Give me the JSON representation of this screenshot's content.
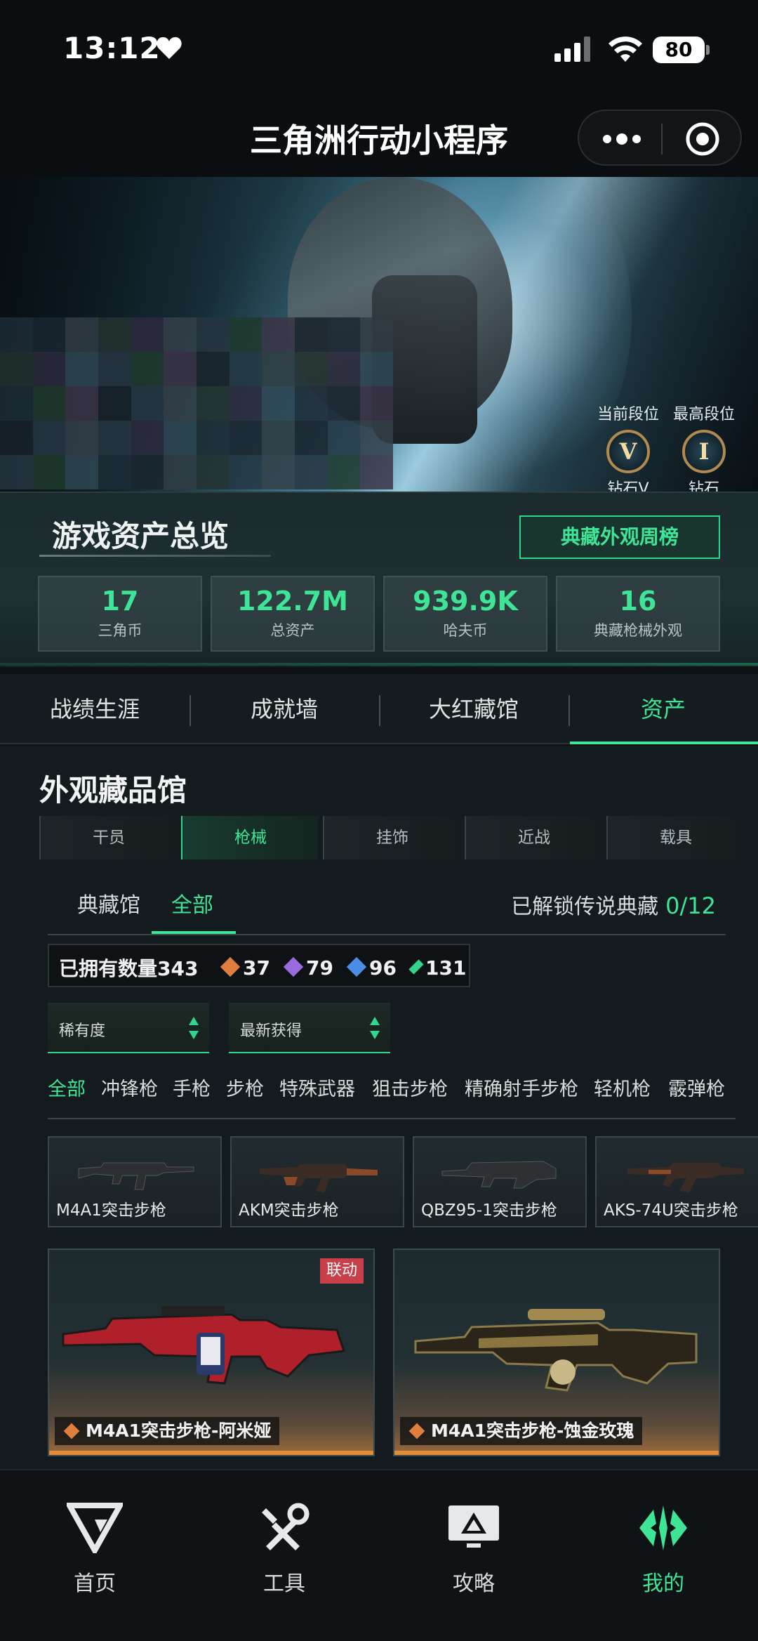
{
  "status_bar": {
    "time": "13:12",
    "battery": "80"
  },
  "title_bar": {
    "title": "三角洲行动小程序"
  },
  "hero": {
    "current_rank_label": "当前段位",
    "current_rank": "钻石V",
    "current_rank_numeral": "V",
    "highest_rank_label": "最高段位",
    "highest_rank": "钻石",
    "highest_rank_numeral": "I"
  },
  "assets": {
    "title": "游戏资产总览",
    "weekly_button": "典藏外观周榜",
    "stats": [
      {
        "value": "17",
        "label": "三角币"
      },
      {
        "value": "122.7M",
        "label": "总资产"
      },
      {
        "value": "939.9K",
        "label": "哈夫币"
      },
      {
        "value": "16",
        "label": "典藏枪械外观"
      }
    ]
  },
  "main_tabs": [
    "战绩生涯",
    "成就墙",
    "大红藏馆",
    "资产"
  ],
  "collection": {
    "title": "外观藏品馆",
    "categories": [
      "干员",
      "枪械",
      "挂饰",
      "近战",
      "载具"
    ],
    "sub_tabs": [
      "典藏馆",
      "全部"
    ],
    "unlock_label": "已解锁传说典藏",
    "unlock_value": "0/12",
    "owned_label": "已拥有数量343",
    "owned_counts": [
      "37",
      "79",
      "96",
      "131"
    ],
    "sort_rarity": "稀有度",
    "sort_recent": "最新获得",
    "filters": [
      "全部",
      "冲锋枪",
      "手枪",
      "步枪",
      "特殊武器",
      "狙击步枪",
      "精确射手步枪",
      "轻机枪",
      "霰弹枪"
    ],
    "weapons": [
      "M4A1突击步枪",
      "AKM突击步枪",
      "QBZ95-1突击步枪",
      "AKS-74U突击步枪"
    ],
    "skins": [
      {
        "name": "M4A1突击步枪-阿米娅",
        "tag": "联动"
      },
      {
        "name": "M4A1突击步枪-蚀金玫瑰"
      }
    ]
  },
  "bottom_nav": [
    "首页",
    "工具",
    "攻略",
    "我的"
  ],
  "colors": {
    "accent": "#3ee596",
    "background": "#0d1113",
    "collab_tag": "#c9404a"
  }
}
